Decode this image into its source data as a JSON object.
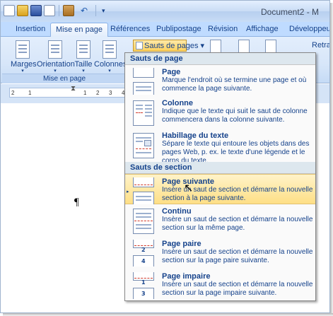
{
  "window": {
    "title": "Document2 - M"
  },
  "quick_access": {
    "undo": "↶",
    "dropdown": "▾"
  },
  "tabs": [
    {
      "label": "Insertion"
    },
    {
      "label": "Mise en page",
      "active": true
    },
    {
      "label": "Références"
    },
    {
      "label": "Publipostage"
    },
    {
      "label": "Révision"
    },
    {
      "label": "Affichage"
    },
    {
      "label": "Développeur"
    }
  ],
  "ribbon": {
    "group_caption": "Mise en page",
    "buttons": [
      {
        "label": "Marges",
        "arrow": "▾"
      },
      {
        "label": "Orientation",
        "arrow": "▾"
      },
      {
        "label": "Taille",
        "arrow": "▾"
      },
      {
        "label": "Colonnes",
        "arrow": "▾"
      }
    ],
    "sauts_button": "Sauts de pages ▾",
    "retrait_label": "Retrait"
  },
  "ruler": {
    "marks": [
      "2",
      "1",
      "1",
      "2",
      "3",
      "4"
    ]
  },
  "document": {
    "pilcrow": "¶"
  },
  "menu": {
    "section_page": "Sauts de page",
    "section_section": "Sauts de section",
    "items": [
      {
        "title": "Page",
        "description": "Marque l'endroit où se termine une page et où commence la page suivante."
      },
      {
        "title": "Colonne",
        "description": "Indique que le texte qui suit le saut de colonne commencera dans la colonne suivante."
      },
      {
        "title": "Habillage du texte",
        "description": "Sépare le texte qui entoure les objets dans des pages Web, p. ex. le texte d'une légende et le corps du texte."
      },
      {
        "title": "Page suivante",
        "description": "Insère un saut de section et démarre la nouvelle section à la page suivante.",
        "highlighted": true
      },
      {
        "title": "Continu",
        "description": "Insère un saut de section et démarre la nouvelle section sur la même page."
      },
      {
        "title": "Page paire",
        "description": "Insère un saut de section et démarre la nouvelle section sur la page paire suivante.",
        "icon_number": "2",
        "icon_number2": "4"
      },
      {
        "title": "Page impaire",
        "description": "Insère un saut de section et démarre la nouvelle section sur la page impaire suivante.",
        "icon_number": "1",
        "icon_number2": "3"
      }
    ]
  },
  "colors": {
    "accent": "#15428b",
    "highlight": "#fedf86",
    "ribbon": "#d7e6f9"
  }
}
